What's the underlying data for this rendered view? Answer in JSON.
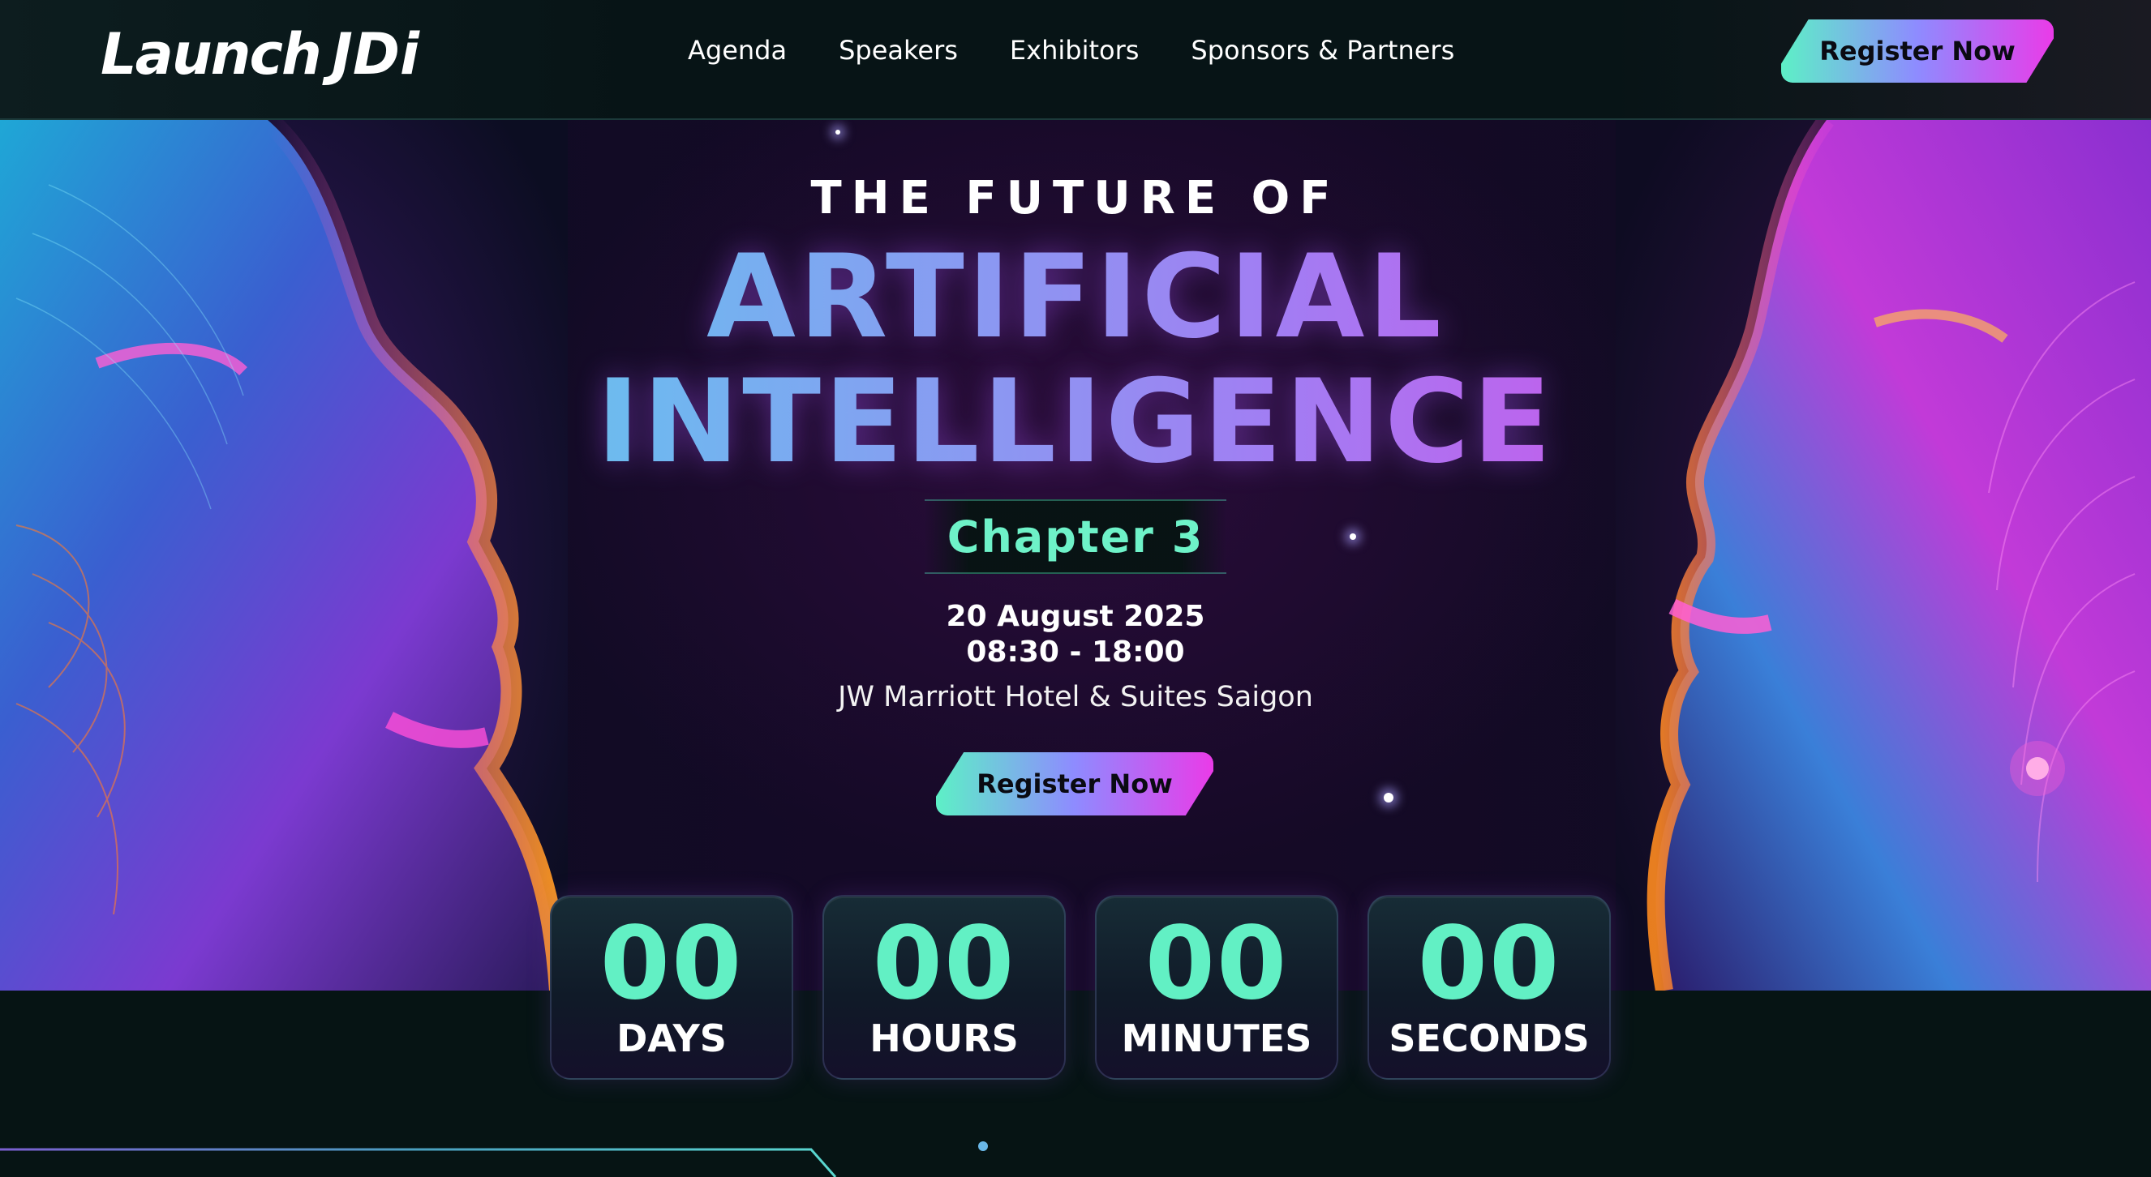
{
  "header": {
    "logo": "Launch JDi",
    "logo_word": "Launch",
    "logo_mark": "JDi",
    "nav": [
      "Agenda",
      "Speakers",
      "Exhibitors",
      "Sponsors & Partners"
    ],
    "cta_label": "Register Now"
  },
  "hero": {
    "kicker": "THE FUTURE OF",
    "title_line1": "ARTIFICIAL",
    "title_line2": "INTELLIGENCE",
    "chapter": "Chapter 3",
    "date": "20 August 2025",
    "time": "08:30 - 18:00",
    "venue": "JW Marriott Hotel & Suites Saigon",
    "cta_label": "Register Now"
  },
  "countdown": [
    {
      "value": "00",
      "label": "DAYS"
    },
    {
      "value": "00",
      "label": "HOURS"
    },
    {
      "value": "00",
      "label": "MINUTES"
    },
    {
      "value": "00",
      "label": "SECONDS"
    }
  ],
  "colors": {
    "accent_teal": "#62f0c4",
    "accent_violet": "#a37cf3",
    "accent_magenta": "#e240e4",
    "background": "#061414"
  }
}
